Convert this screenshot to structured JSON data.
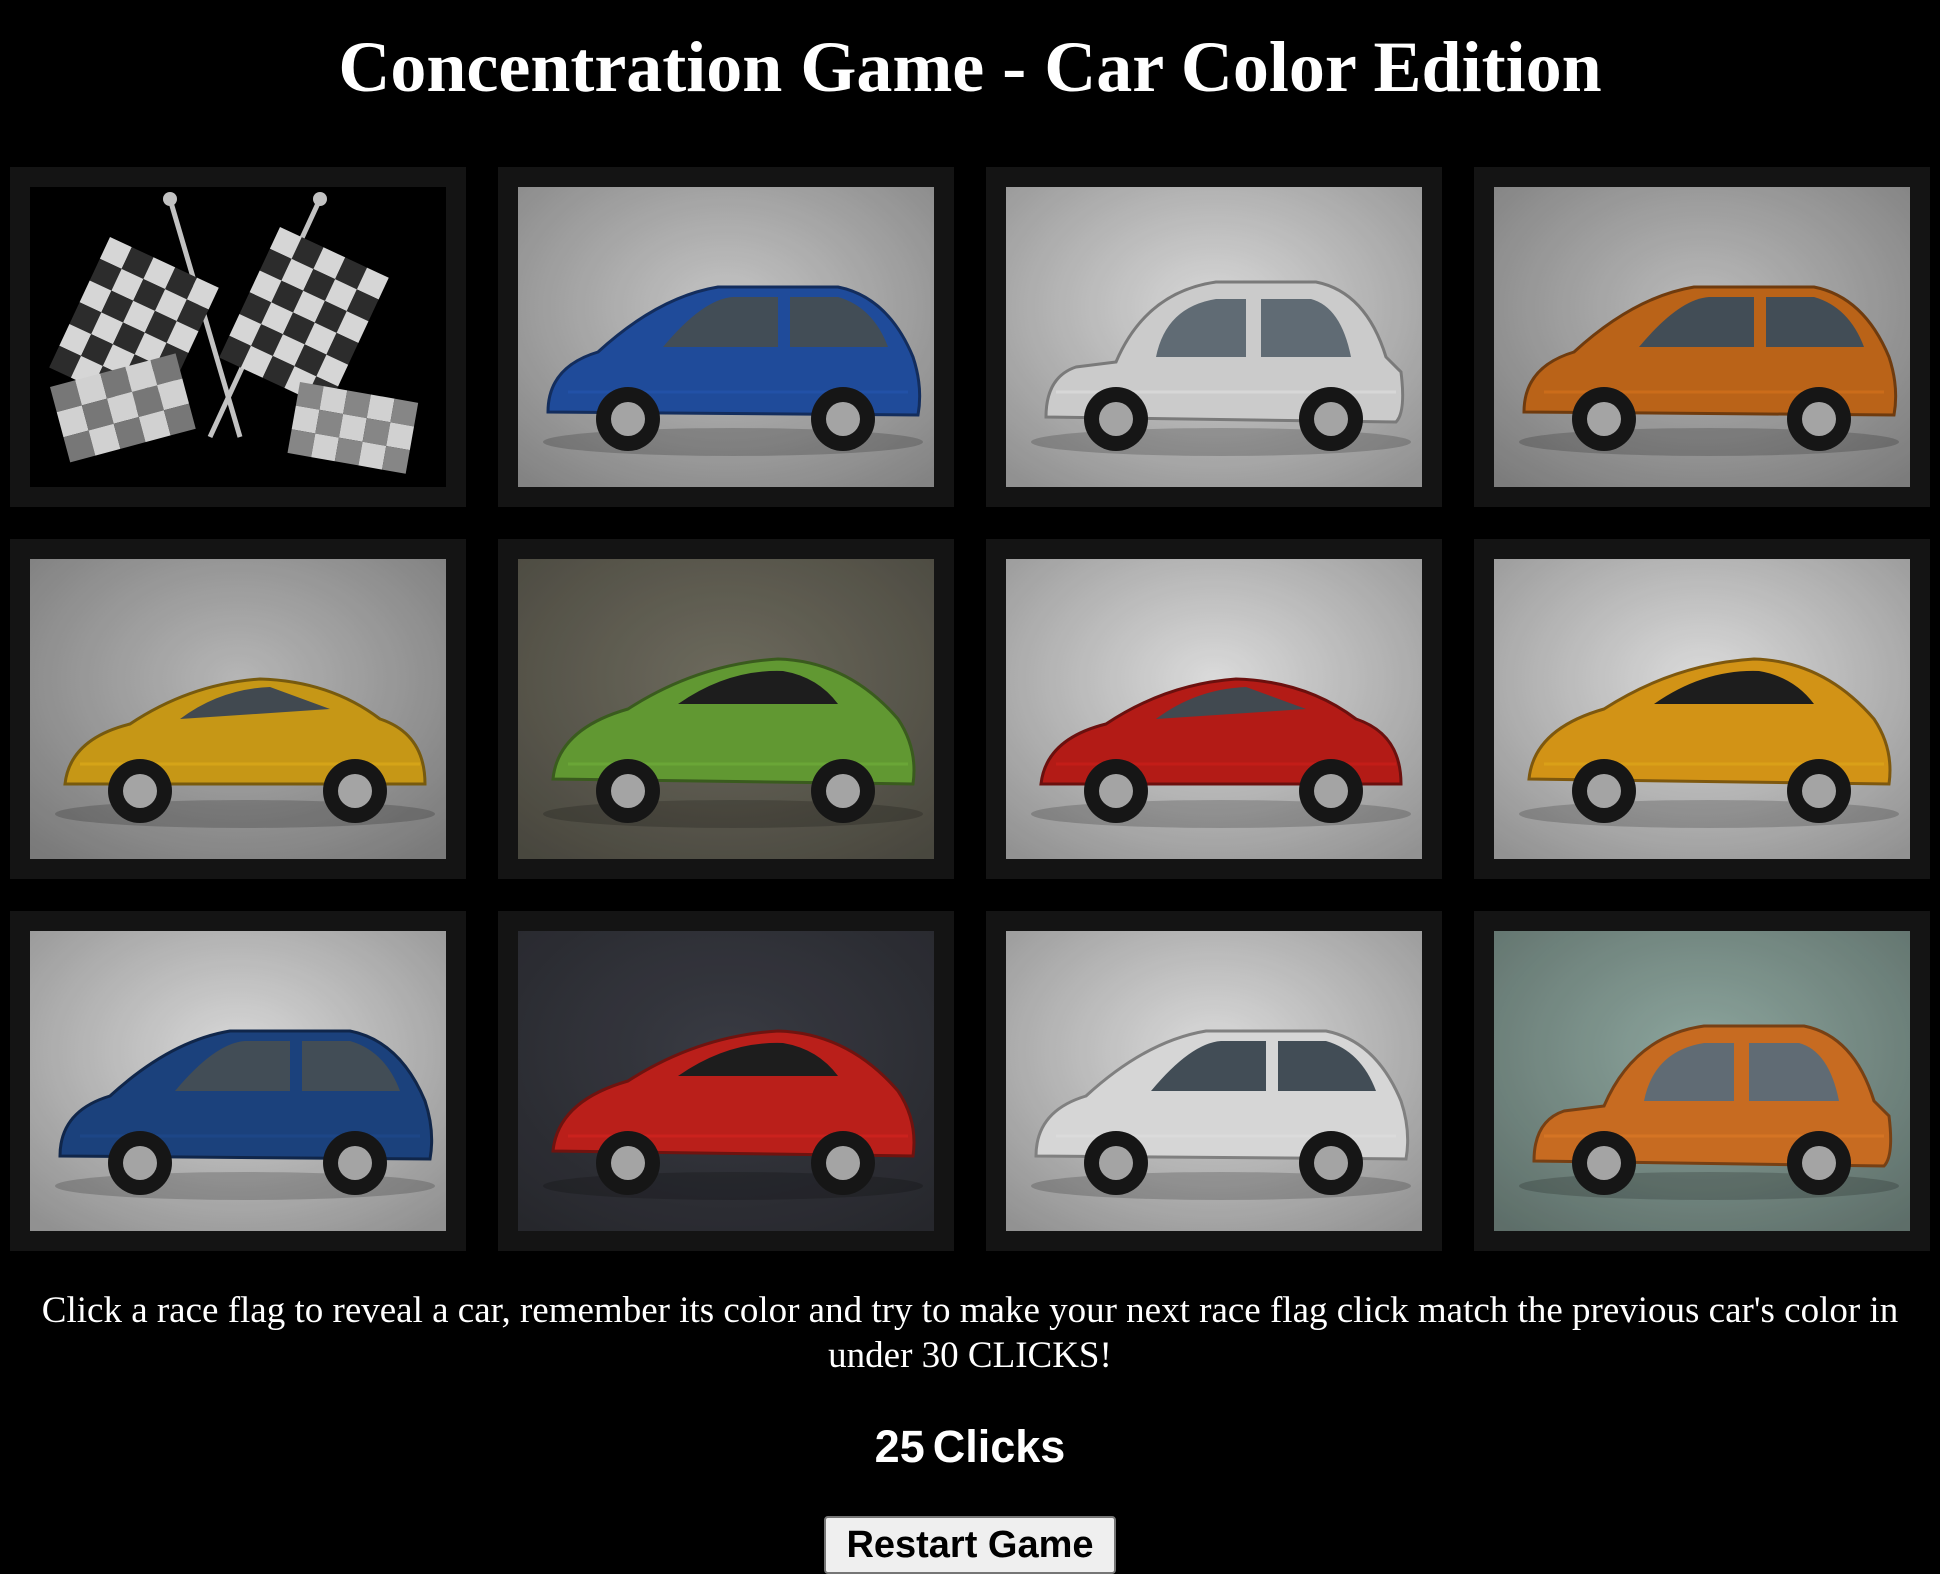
{
  "title": "Concentration Game - Car Color Edition",
  "instructions": "Click a race flag to reveal a car, remember its color and try to make your next race flag click match the previous car's color in under 30 CLICKS!",
  "clicks": {
    "count": "25",
    "label": "Clicks"
  },
  "restart_label": "Restart Game",
  "cards": [
    {
      "state": "hidden",
      "face": "race-flags",
      "color": "#ffffff"
    },
    {
      "state": "revealed",
      "face": "wagon",
      "color": "#2456b0"
    },
    {
      "state": "revealed",
      "face": "classic-small",
      "color": "#e8e8e8"
    },
    {
      "state": "revealed",
      "face": "wagon",
      "color": "#d4711c"
    },
    {
      "state": "revealed",
      "face": "convertible",
      "color": "#e2ac1a"
    },
    {
      "state": "revealed",
      "face": "supercar",
      "color": "#6fae3a"
    },
    {
      "state": "revealed",
      "face": "coupe",
      "color": "#cc1f1a"
    },
    {
      "state": "revealed",
      "face": "roadster",
      "color": "#f0a81a"
    },
    {
      "state": "revealed",
      "face": "hatchback",
      "color": "#1f4a8e"
    },
    {
      "state": "revealed",
      "face": "supercar",
      "color": "#d4241e"
    },
    {
      "state": "revealed",
      "face": "hatchback",
      "color": "#f4f4f4"
    },
    {
      "state": "revealed",
      "face": "classic-small",
      "color": "#e37a26"
    }
  ],
  "backgrounds": [
    "#000000",
    "#c8c8c8",
    "#dcdcdc",
    "#bdbdbd",
    "#b9b9b9",
    "#6f6c5f",
    "#dedede",
    "#dedede",
    "#dcdcdc",
    "#3a3c44",
    "#dedede",
    "#8fa8a0"
  ]
}
